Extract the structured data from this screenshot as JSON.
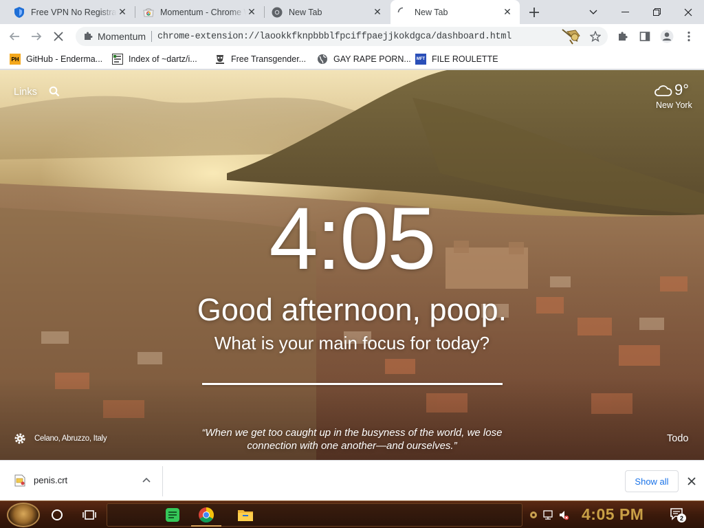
{
  "tabs": [
    {
      "title": "Free VPN No Registra",
      "favicon": "vpn-shield-icon"
    },
    {
      "title": "Momentum - Chrome W",
      "favicon": "chrome-web-store-icon"
    },
    {
      "title": "New Tab",
      "favicon": "chrome-icon"
    },
    {
      "title": "New Tab",
      "favicon": "loading-spinner-icon",
      "active": true
    }
  ],
  "toolbar": {
    "site_name": "Momentum",
    "url": "chrome-extension://laookkfknpbbblfpciffpaejjkokdgca/dashboard.html"
  },
  "bookmarks": [
    {
      "label": "GitHub - Enderma...",
      "icon": "PH"
    },
    {
      "label": "Index of ~dartz/i...",
      "icon": "index-icon"
    },
    {
      "label": "Free Transgender...",
      "icon": "bookmark-site-icon"
    },
    {
      "label": "GAY RAPE PORN...",
      "icon": "globe-icon"
    },
    {
      "label": "FILE ROULETTE",
      "icon": "MFT"
    }
  ],
  "momentum": {
    "links_label": "Links",
    "temperature": "9°",
    "city": "New York",
    "time": "4:05",
    "greeting": "Good afternoon, poop.",
    "focus_question": "What is your main focus for today?",
    "location": "Celano, Abruzzo, Italy",
    "quote": "“When we get too caught up in the busyness of the world, we lose connection with one another—and ourselves.”",
    "todo_label": "Todo"
  },
  "downloads": {
    "file_name": "penis.crt",
    "show_all_label": "Show all"
  },
  "taskbar": {
    "time": "4:05 PM",
    "notification_count": "2"
  },
  "colors": {
    "chrome_frame": "#dee1e6",
    "active_tab": "#ffffff",
    "link_blue": "#1a73e8",
    "taskbar_brown": "#3c1a0b",
    "taskbar_clock": "#c9a046"
  }
}
